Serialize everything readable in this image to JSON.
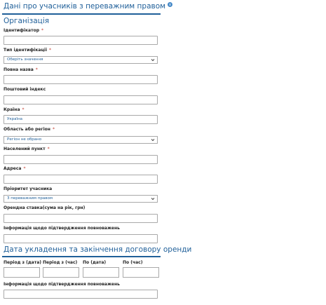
{
  "header": {
    "title": "Дані про учасників з переважним правом"
  },
  "organization": {
    "title": "Організація",
    "fields": {
      "identifier": {
        "label": "Ідентифікатор",
        "required_mark": "*",
        "value": ""
      },
      "id_type": {
        "label": "Тип ідентифікації",
        "required_mark": "*",
        "value": "Оберіть значення"
      },
      "full_name": {
        "label": "Повна назва",
        "required_mark": "*",
        "value": ""
      },
      "postal_code": {
        "label": "Поштовий індекс",
        "value": ""
      },
      "country": {
        "label": "Країна",
        "required_mark": "*",
        "value": "Україна"
      },
      "region": {
        "label": "Область або регіон",
        "required_mark": "*",
        "value": "Регіон не обрано"
      },
      "locality": {
        "label": "Населений пункт",
        "required_mark": "*",
        "value": ""
      },
      "address": {
        "label": "Адреса",
        "required_mark": "*",
        "value": ""
      },
      "priority": {
        "label": "Пріоритет учасника",
        "value": "З переважним правом"
      },
      "rent_rate": {
        "label": "Орендна ставка(сума на рік, грн)",
        "value": ""
      },
      "authority_info": {
        "label": "Інформація щодо підтвердження повноважень",
        "value": ""
      }
    }
  },
  "contract_dates": {
    "title": "Дата укладення та закінчення договору оренди",
    "columns": [
      {
        "label": "Період з (дата)",
        "value": ""
      },
      {
        "label": "Період з (час)",
        "value": ""
      },
      {
        "label": "По (дата)",
        "value": ""
      },
      {
        "label": "По (час)",
        "value": ""
      }
    ],
    "authority_info": {
      "label": "Інформація щодо підтвердження повноважень",
      "value": ""
    }
  }
}
